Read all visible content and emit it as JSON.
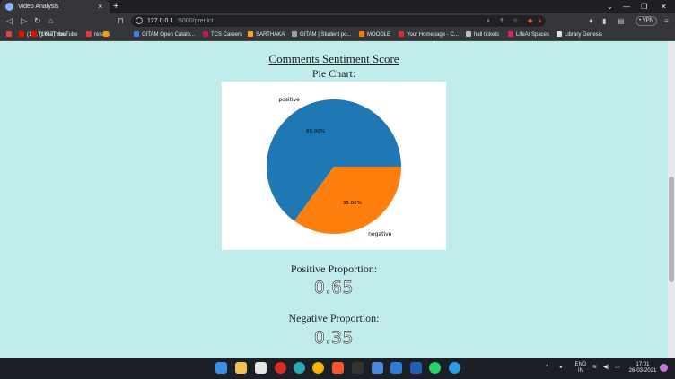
{
  "browser": {
    "tab_title": "Video Analysis",
    "tab_close": "×",
    "new_tab": "+",
    "url_host": "127.0.0.1",
    "url_path": ":5000/predict",
    "vpn_label": "• VPN",
    "bookmarks": [
      {
        "label": "",
        "color": "#ea4335"
      },
      {
        "label": "(1617) YouTube",
        "color": "#ff0000"
      },
      {
        "label": "results",
        "color": "#e53935"
      },
      {
        "label": "",
        "color": "#f4a100"
      },
      {
        "label": "GITAM Open Catalo...",
        "color": "#3f7fe0"
      },
      {
        "label": "TCS Careers",
        "color": "#c2185b"
      },
      {
        "label": "SARTHAKA",
        "color": "#f9a825"
      },
      {
        "label": "GITAM | Student po...",
        "color": "#9e9e9e"
      },
      {
        "label": "MOODLE",
        "color": "#f57c00"
      },
      {
        "label": "Your Homepage - C...",
        "color": "#d32f2f"
      },
      {
        "label": "hall tickets",
        "color": "#bdbdbd"
      },
      {
        "label": "LifeAt Spaces",
        "color": "#e91e63"
      },
      {
        "label": "Library Genesis",
        "color": "#e0e0e0"
      }
    ]
  },
  "page": {
    "title": "Comments Sentiment Score",
    "chart_caption": "Pie Chart:",
    "positive_label": "Positive Proportion:",
    "positive_value": "0.65",
    "negative_label": "Negative Proportion:",
    "negative_value": "0.35"
  },
  "chart_data": {
    "type": "pie",
    "slices": [
      {
        "label": "positive",
        "value": 65.0,
        "pct_label": "65.00%",
        "color": "#1f77b4"
      },
      {
        "label": "negative",
        "value": 35.0,
        "pct_label": "35.00%",
        "color": "#ff7f0e"
      }
    ],
    "start_angle_deg": 0,
    "direction": "counterclockwise"
  },
  "taskbar": {
    "lang_top": "ENG",
    "lang_bottom": "IN",
    "time": "17:01",
    "date": "26-03-2021"
  }
}
